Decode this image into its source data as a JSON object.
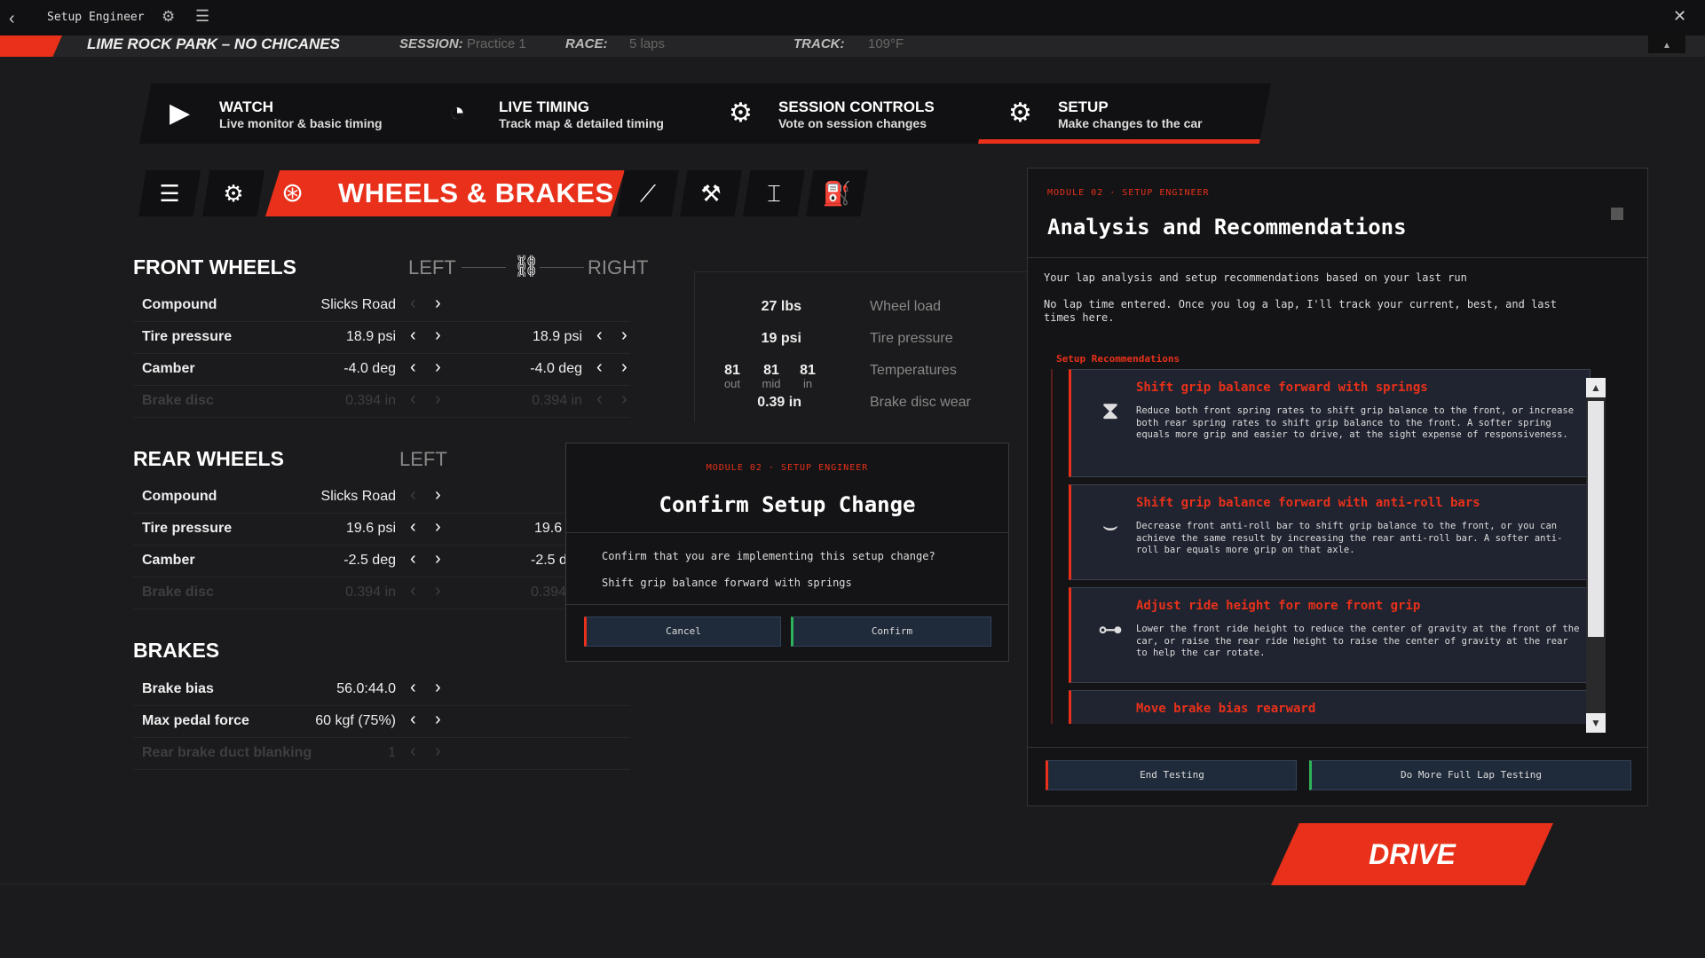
{
  "os_bar": {
    "title": "Setup Engineer",
    "back_icon": "‹",
    "close_icon": "✕"
  },
  "session_strip": {
    "track": "LIME ROCK PARK – NO CHICANES",
    "session_label": "SESSION:",
    "session_value": "Practice 1",
    "race_label": "RACE:",
    "race_value": "5 laps",
    "track_label": "TRACK:",
    "track_value": "109°F"
  },
  "nav_tabs": [
    {
      "title": "WATCH",
      "subtitle": "Live monitor & basic timing",
      "icon": "camera-icon"
    },
    {
      "title": "LIVE TIMING",
      "subtitle": "Track map & detailed timing",
      "icon": "stopwatch-icon"
    },
    {
      "title": "SESSION CONTROLS",
      "subtitle": "Vote on session changes",
      "icon": "gear-icon"
    },
    {
      "title": "SETUP",
      "subtitle": "Make changes to the car",
      "icon": "wrench-gear-icon",
      "active": true
    }
  ],
  "sub_tabs": {
    "active_label": "WHEELS & BRAKES",
    "icons": [
      "list-icon",
      "gears-icon",
      "wheel-icon",
      "spring-icon",
      "wrench-icon",
      "axle-icon",
      "fuel-icon"
    ]
  },
  "front_wheels": {
    "title": "FRONT WHEELS",
    "left_label": "LEFT",
    "right_label": "RIGHT",
    "rows": [
      {
        "name": "Compound",
        "left": "Slicks Road",
        "right": ""
      },
      {
        "name": "Tire pressure",
        "left": "18.9 psi",
        "right": "18.9 psi"
      },
      {
        "name": "Camber",
        "left": "-4.0 deg",
        "right": "-4.0 deg"
      },
      {
        "name": "Brake disc",
        "left": "0.394 in",
        "right": "0.394 in"
      }
    ]
  },
  "wheel_info": {
    "wheel_load": "27 lbs",
    "wheel_load_label": "Wheel load",
    "tire_pressure": "19 psi",
    "tire_pressure_label": "Tire pressure",
    "temps": [
      {
        "v": "81",
        "s": "out"
      },
      {
        "v": "81",
        "s": "mid"
      },
      {
        "v": "81",
        "s": "in"
      }
    ],
    "temps_label": "Temperatures",
    "disc_wear": "0.39 in",
    "disc_wear_label": "Brake disc wear"
  },
  "rear_wheels": {
    "title": "REAR WHEELS",
    "left_label": "LEFT",
    "rows": [
      {
        "name": "Compound",
        "left": "Slicks Road",
        "right": ""
      },
      {
        "name": "Tire pressure",
        "left": "19.6 psi",
        "right": "19.6"
      },
      {
        "name": "Camber",
        "left": "-2.5 deg",
        "right": "-2.5 d"
      },
      {
        "name": "Brake disc",
        "left": "0.394 in",
        "right": "0.394"
      }
    ]
  },
  "brakes": {
    "title": "BRAKES",
    "rows": [
      {
        "name": "Brake bias",
        "value": "56.0:44.0"
      },
      {
        "name": "Max pedal force",
        "value": "60 kgf (75%)"
      },
      {
        "name": "Rear brake duct blanking",
        "value": "1"
      }
    ]
  },
  "confirm_modal": {
    "tag": "MODULE 02  ·  SETUP ENGINEER",
    "title": "Confirm Setup Change",
    "question": "Confirm that you are implementing this setup change?",
    "detail": "Shift grip balance forward with springs",
    "cancel": "Cancel",
    "confirm": "Confirm"
  },
  "analysis": {
    "tag": "MODULE 02  ·  SETUP ENGINEER",
    "title": "Analysis and Recommendations",
    "intro": "Your lap analysis and setup recommendations based on your last run",
    "note": "No lap time entered. Once you log a lap, I'll track your current, best, and last times here.",
    "sub_title": "Setup Recommendations",
    "recs": [
      {
        "title": "Shift grip balance forward with springs",
        "icon": "spring-icon",
        "desc": "Reduce both front spring rates to shift grip balance to the front, or increase both rear spring rates to shift grip balance to the front. A softer spring equals more grip and easier to drive, at the sight expense of responsiveness."
      },
      {
        "title": "Shift grip balance forward with anti-roll bars",
        "icon": "anti-roll-bar-icon",
        "desc": "Decrease front anti-roll bar to shift grip balance to the front, or you can achieve the same result by increasing the rear anti-roll bar. A softer anti-roll bar equals more grip on that axle."
      },
      {
        "title": "Adjust ride height for more front grip",
        "icon": "car-icon",
        "desc": "Lower the front ride height to reduce the center of gravity at the front of the car, or raise the rear ride height to raise the center of gravity at the rear to help the car rotate."
      },
      {
        "title": "Move brake bias rearward",
        "icon": "brake-icon",
        "desc": ""
      }
    ],
    "end_testing": "End Testing",
    "more_testing": "Do More Full Lap Testing"
  },
  "drive_label": "DRIVE"
}
